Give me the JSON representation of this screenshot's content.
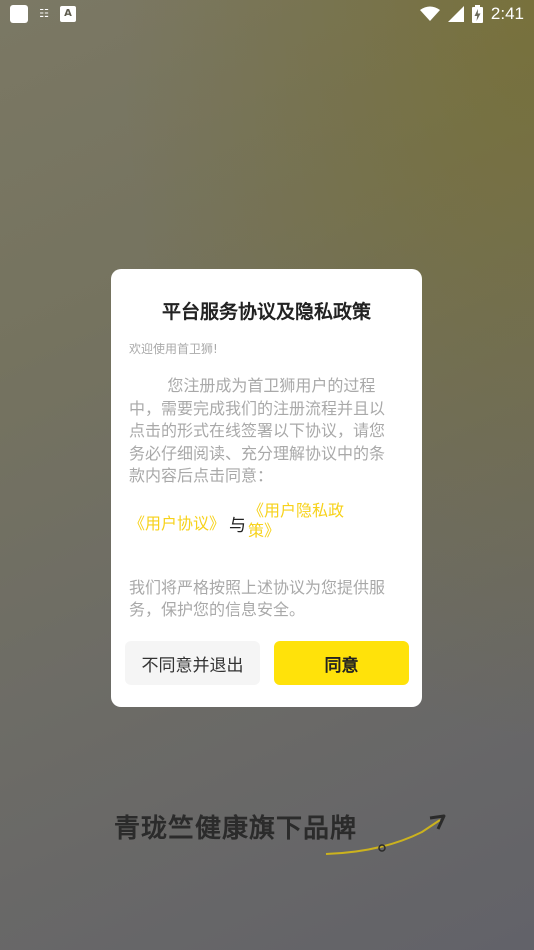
{
  "status_bar": {
    "time": "2:41",
    "left_icons": [
      "app-square-icon",
      "qr-grid-icon",
      "a-letter-icon"
    ],
    "right_icons": [
      "wifi-icon",
      "signal-icon",
      "battery-charging-icon"
    ],
    "qr_glyph": "☷",
    "a_glyph": "A"
  },
  "dialog": {
    "title": "平台服务协议及隐私政策",
    "welcome": "欢迎使用首卫狮!",
    "paragraph": "您注册成为首卫狮用户的过程中，需要完成我们的注册流程并且以点击的形式在线签署以下协议，请您务必仔细阅读、充分理解协议中的条款内容后点击同意：",
    "user_agreement_link": "《用户协议》",
    "and_text": "与",
    "privacy_policy_link": "《用户隐私政策》",
    "paragraph2": "我们将严格按照上述协议为您提供服务，保护您的信息安全。",
    "disagree_button": "不同意并退出",
    "agree_button": "同意"
  },
  "brand": {
    "slogan": "青珑竺健康旗下品牌"
  },
  "colors": {
    "accent_yellow": "#ffe20a",
    "link_yellow": "#f7d21a",
    "text_dark": "#222222",
    "text_gray": "#a9a9a9"
  }
}
